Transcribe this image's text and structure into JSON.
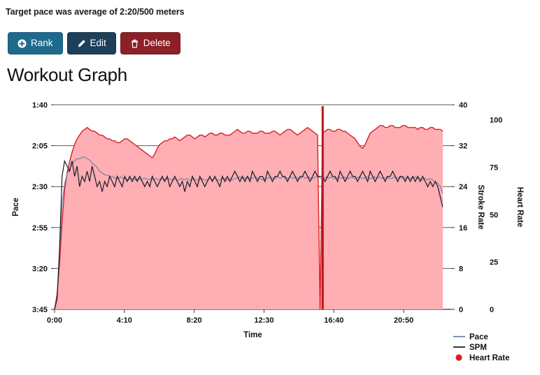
{
  "header": {
    "target_note": "Target pace was average of 2:20/500 meters"
  },
  "toolbar": {
    "buttons": [
      {
        "label": "Rank",
        "icon": "plus-circle-icon",
        "color": "#1d6a8c"
      },
      {
        "label": "Edit",
        "icon": "pencil-icon",
        "color": "#1e3f5a"
      },
      {
        "label": "Delete",
        "icon": "trash-icon",
        "color": "#8c2027"
      }
    ]
  },
  "page": {
    "title": "Workout Graph"
  },
  "legend": {
    "items": [
      {
        "label": "Pace",
        "marker": "line",
        "color": "#6f86a8"
      },
      {
        "label": "SPM",
        "marker": "line",
        "color": "#1a1a22"
      },
      {
        "label": "Heart Rate",
        "marker": "dot",
        "color": "#d81f26"
      }
    ]
  },
  "chart_data": {
    "type": "line",
    "title": "Workout Graph",
    "xlabel": "Time",
    "grid": true,
    "legend_position": "bottom-right",
    "x_ticks": [
      "0:00",
      "4:10",
      "8:20",
      "12:30",
      "16:40",
      "20:50"
    ],
    "x_tick_values": [
      0,
      250,
      500,
      750,
      1000,
      1250
    ],
    "xlim": [
      0,
      1420
    ],
    "axes": [
      {
        "name": "Pace",
        "side": "left",
        "ylabel": "Pace",
        "ticks": [
          "1:40",
          "2:05",
          "2:30",
          "2:55",
          "3:20",
          "3:45"
        ],
        "tick_seconds": [
          100,
          125,
          150,
          175,
          200,
          225
        ],
        "ylim_seconds": [
          100,
          225
        ],
        "inverted": true
      },
      {
        "name": "Stroke Rate",
        "side": "right",
        "ylabel": "Stroke Rate",
        "ticks": [
          40,
          32,
          24,
          16,
          8,
          0
        ],
        "ylim": [
          0,
          40
        ]
      },
      {
        "name": "Heart Rate",
        "side": "right",
        "ylabel": "Heart Rate",
        "ticks": [
          100,
          75,
          50,
          25,
          0
        ],
        "ylim": [
          0,
          108
        ]
      }
    ],
    "series": [
      {
        "name": "Heart Rate",
        "axis": "Heart Rate",
        "color": "#d81f26",
        "fill": "#ffaeb4",
        "style": "area",
        "values": [
          0,
          8,
          24,
          46,
          63,
          72,
          78,
          83,
          87,
          90,
          92,
          94,
          95,
          96,
          95,
          94,
          94,
          93,
          92,
          92,
          91,
          90,
          90,
          89,
          89,
          88,
          88,
          89,
          90,
          90,
          89,
          88,
          87,
          86,
          85,
          84,
          83,
          82,
          81,
          80,
          82,
          85,
          87,
          88,
          89,
          89,
          90,
          90,
          91,
          90,
          89,
          90,
          91,
          92,
          92,
          91,
          90,
          91,
          92,
          92,
          91,
          92,
          93,
          93,
          92,
          92,
          93,
          93,
          92,
          92,
          92,
          93,
          94,
          95,
          94,
          93,
          93,
          94,
          94,
          93,
          93,
          93,
          94,
          94,
          93,
          93,
          93,
          94,
          94,
          93,
          92,
          93,
          94,
          95,
          95,
          94,
          93,
          92,
          93,
          94,
          95,
          96,
          95,
          94,
          93,
          92,
          0,
          93,
          94,
          95,
          95,
          94,
          94,
          95,
          95,
          94,
          94,
          93,
          92,
          91,
          90,
          88,
          86,
          85,
          87,
          90,
          93,
          94,
          95,
          96,
          97,
          97,
          96,
          96,
          97,
          97,
          96,
          96,
          96,
          97,
          97,
          96,
          96,
          96,
          96,
          95,
          96,
          96,
          95,
          95,
          96,
          96,
          95,
          95,
          95,
          94
        ]
      },
      {
        "name": "SPM",
        "axis": "Stroke Rate",
        "color": "#1a1a22",
        "style": "line",
        "values": [
          0,
          2,
          12,
          26,
          29,
          28,
          27,
          29,
          26,
          28,
          24,
          26,
          25,
          27,
          25,
          28,
          26,
          24,
          25,
          23,
          25,
          24,
          26,
          25,
          24,
          26,
          25,
          24,
          26,
          25,
          26,
          25,
          26,
          25,
          26,
          25,
          24,
          25,
          24,
          26,
          25,
          24,
          25,
          26,
          25,
          26,
          24,
          25,
          26,
          25,
          24,
          25,
          23,
          25,
          24,
          26,
          25,
          24,
          26,
          25,
          24,
          25,
          26,
          25,
          26,
          25,
          24,
          26,
          25,
          26,
          25,
          26,
          27,
          26,
          25,
          26,
          25,
          26,
          25,
          27,
          26,
          25,
          26,
          26,
          25,
          27,
          26,
          25,
          26,
          26,
          27,
          26,
          26,
          25,
          26,
          27,
          26,
          25,
          26,
          26,
          27,
          26,
          25,
          26,
          27,
          26,
          26,
          26,
          25,
          26,
          27,
          26,
          26,
          25,
          27,
          26,
          25,
          26,
          27,
          26,
          26,
          25,
          26,
          27,
          26,
          25,
          27,
          26,
          25,
          26,
          27,
          26,
          25,
          26,
          26,
          27,
          26,
          25,
          26,
          26,
          25,
          26,
          25,
          26,
          25,
          26,
          25,
          26,
          25,
          24,
          25,
          24,
          25,
          24,
          22,
          20
        ]
      },
      {
        "name": "Pace",
        "axis": "Pace",
        "color": "#6f86a8",
        "style": "line",
        "values": [
          225,
          218,
          190,
          160,
          148,
          142,
          139,
          136,
          134,
          133,
          133,
          132,
          132,
          133,
          134,
          136,
          137,
          139,
          141,
          142,
          143,
          143,
          144,
          144,
          145,
          145,
          144,
          145,
          145,
          146,
          145,
          145,
          146,
          145,
          146,
          145,
          145,
          146,
          145,
          146,
          145,
          146,
          145,
          146,
          145,
          145,
          146,
          145,
          146,
          146,
          145,
          146,
          145,
          146,
          146,
          145,
          146,
          146,
          145,
          146,
          146,
          145,
          146,
          145,
          146,
          146,
          145,
          145,
          146,
          145,
          146,
          145,
          145,
          144,
          145,
          145,
          144,
          145,
          145,
          144,
          145,
          145,
          146,
          145,
          145,
          144,
          145,
          145,
          144,
          145,
          144,
          145,
          145,
          144,
          145,
          144,
          145,
          145,
          144,
          145,
          144,
          145,
          145,
          144,
          144,
          145,
          145,
          144,
          145,
          144,
          145,
          145,
          144,
          145,
          144,
          145,
          145,
          144,
          145,
          145,
          144,
          145,
          145,
          144,
          145,
          145,
          144,
          145,
          144,
          145,
          145,
          144,
          145,
          145,
          144,
          145,
          144,
          145,
          145,
          144,
          145,
          145,
          144,
          145,
          145,
          146,
          145,
          146,
          145,
          146,
          147,
          148,
          150,
          154
        ]
      }
    ],
    "annotations": [
      {
        "type": "vertical-dropout",
        "x_value": 960,
        "color": "#b5161c",
        "note": "heart rate signal dropout"
      }
    ]
  }
}
